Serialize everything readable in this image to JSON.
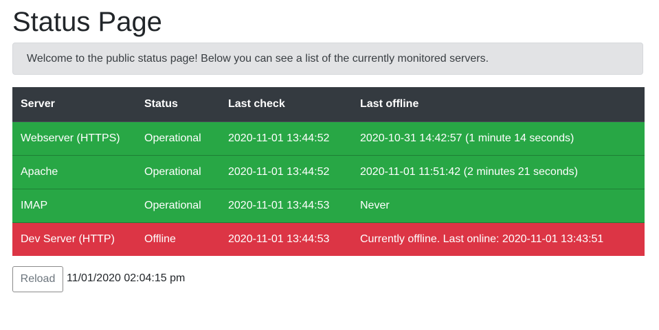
{
  "page": {
    "title": "Status Page",
    "notice": "Welcome to the public status page! Below you can see a list of the currently monitored servers."
  },
  "table": {
    "headers": {
      "server": "Server",
      "status": "Status",
      "last_check": "Last check",
      "last_offline": "Last offline"
    },
    "rows": [
      {
        "server": "Webserver (HTTPS)",
        "status": "Operational",
        "last_check": "2020-11-01 13:44:52",
        "last_offline": "2020-10-31 14:42:57 (1 minute 14 seconds)",
        "state": "ok"
      },
      {
        "server": "Apache",
        "status": "Operational",
        "last_check": "2020-11-01 13:44:52",
        "last_offline": "2020-11-01 11:51:42 (2 minutes 21 seconds)",
        "state": "ok"
      },
      {
        "server": "IMAP",
        "status": "Operational",
        "last_check": "2020-11-01 13:44:53",
        "last_offline": "Never",
        "state": "ok"
      },
      {
        "server": "Dev Server (HTTP)",
        "status": "Offline",
        "last_check": "2020-11-01 13:44:53",
        "last_offline": "Currently offline. Last online: 2020-11-01 13:43:51",
        "state": "offline"
      }
    ]
  },
  "footer": {
    "reload_label": "Reload",
    "timestamp": "11/01/2020 02:04:15 pm"
  },
  "colors": {
    "operational": "#28a745",
    "offline": "#dc3545",
    "header_bg": "#343a40",
    "notice_bg": "#e2e3e5"
  }
}
